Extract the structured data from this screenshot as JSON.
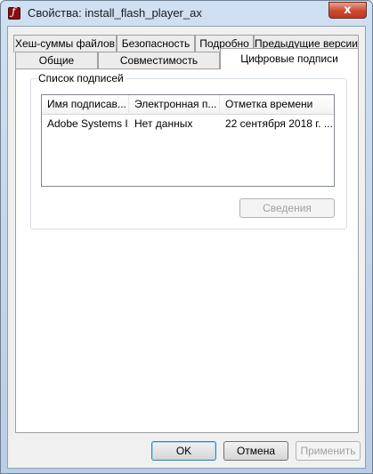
{
  "window": {
    "title": "Свойства: install_flash_player_ax",
    "close_glyph": "x"
  },
  "tabs": {
    "row1": [
      "Хеш-суммы файлов",
      "Безопасность",
      "Подробно",
      "Предыдущие версии"
    ],
    "row2": [
      "Общие",
      "Совместимость",
      "Цифровые подписи"
    ],
    "active": "Цифровые подписи"
  },
  "signatures": {
    "group_label": "Список подписей",
    "columns": [
      "Имя подписав...",
      "Электронная п...",
      "Отметка времени"
    ],
    "rows": [
      [
        "Adobe Systems I...",
        "Нет данных",
        "22 сентября 2018 г. ..."
      ]
    ],
    "details_button": "Сведения"
  },
  "footer": {
    "ok": "OK",
    "cancel": "Отмена",
    "apply": "Применить"
  }
}
